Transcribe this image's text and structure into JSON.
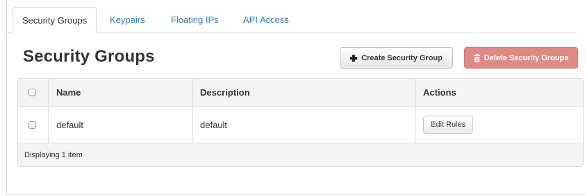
{
  "tabs": [
    {
      "label": "Security Groups",
      "active": true
    },
    {
      "label": "Keypairs",
      "active": false
    },
    {
      "label": "Floating IPs",
      "active": false
    },
    {
      "label": "API Access",
      "active": false
    }
  ],
  "page_title": "Security Groups",
  "toolbar": {
    "create_label": "Create Security Group",
    "delete_label": "Delete Security Groups",
    "create_icon": "plus-icon",
    "delete_icon": "trash-icon",
    "delete_color": "#e08a85"
  },
  "table": {
    "columns": [
      "Name",
      "Description",
      "Actions"
    ],
    "rows": [
      {
        "name": "default",
        "description": "default",
        "action_label": "Edit Rules"
      }
    ],
    "footer": "Displaying 1 item"
  },
  "colors": {
    "link": "#2a7fc1",
    "header_bg": "#f4f4f4",
    "border": "#dddddd"
  }
}
